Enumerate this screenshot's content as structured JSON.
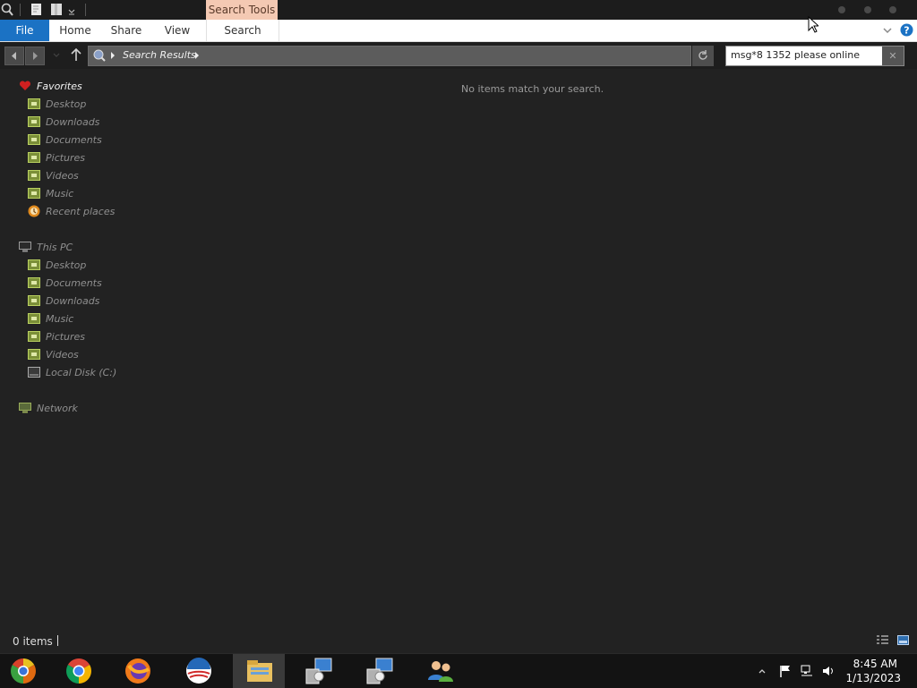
{
  "titlebar": {
    "context_tab": "Search Tools"
  },
  "ribbon": {
    "tabs": [
      "File",
      "Home",
      "Share",
      "View",
      "Search"
    ]
  },
  "address": {
    "path": "Search Results"
  },
  "search": {
    "value": "msg*8 1352 please online",
    "clear_label": "✕"
  },
  "nav": {
    "favorites": {
      "label": "Favorites",
      "items": [
        "Desktop",
        "Downloads",
        "Documents",
        "Pictures",
        "Videos",
        "Music",
        "Recent places"
      ]
    },
    "this_pc": {
      "label": "This PC",
      "items": [
        "Desktop",
        "Documents",
        "Downloads",
        "Music",
        "Pictures",
        "Videos",
        "Local Disk (C:)"
      ]
    },
    "network": {
      "label": "Network"
    }
  },
  "content": {
    "empty_message": "No items match your search."
  },
  "status": {
    "items": "0 items"
  },
  "taskbar": {
    "apps": [
      "chrome-canary-icon",
      "chrome-icon",
      "firefox-icon",
      "obama-logo-icon",
      "file-explorer-icon",
      "network-setup-icon",
      "network-setup-icon",
      "users-icon"
    ],
    "time": "8:45 AM",
    "date": "1/13/2023"
  },
  "colors": {
    "accent": "#1b72c4",
    "context_tab": "#f4c9b3",
    "background": "#222222"
  }
}
